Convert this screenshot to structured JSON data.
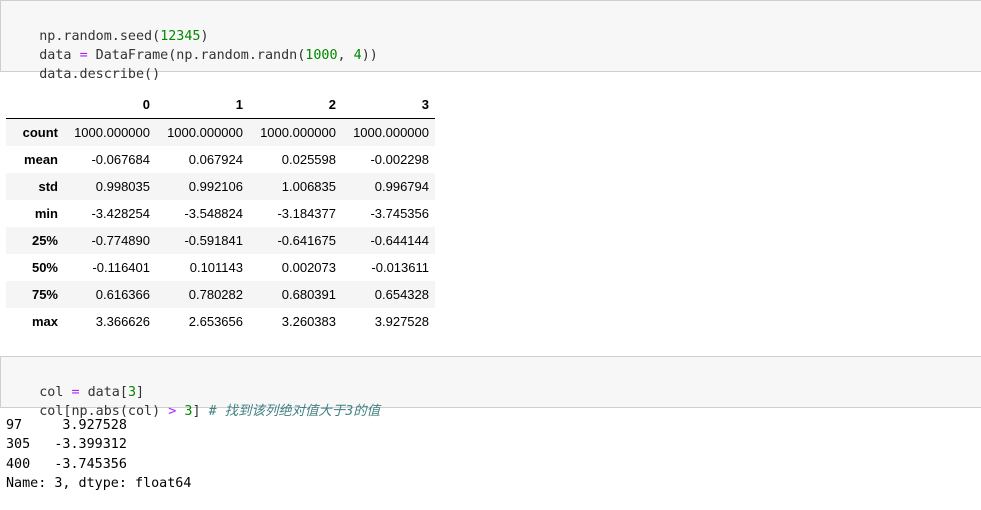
{
  "cell1": {
    "lines": [
      {
        "parts": [
          {
            "t": "np.random.seed(",
            "c": "plain"
          },
          {
            "t": "12345",
            "c": "num"
          },
          {
            "t": ")",
            "c": "plain"
          }
        ]
      },
      {
        "parts": [
          {
            "t": "data ",
            "c": "plain"
          },
          {
            "t": "=",
            "c": "op"
          },
          {
            "t": " DataFrame(np.random.randn(",
            "c": "plain"
          },
          {
            "t": "1000",
            "c": "num"
          },
          {
            "t": ", ",
            "c": "plain"
          },
          {
            "t": "4",
            "c": "num"
          },
          {
            "t": "))",
            "c": "plain"
          }
        ]
      },
      {
        "parts": [
          {
            "t": "data.describe()",
            "c": "plain"
          }
        ]
      }
    ]
  },
  "describe_table": {
    "columns": [
      "0",
      "1",
      "2",
      "3"
    ],
    "rows": [
      {
        "index": "count",
        "values": [
          "1000.000000",
          "1000.000000",
          "1000.000000",
          "1000.000000"
        ]
      },
      {
        "index": "mean",
        "values": [
          "-0.067684",
          "0.067924",
          "0.025598",
          "-0.002298"
        ]
      },
      {
        "index": "std",
        "values": [
          "0.998035",
          "0.992106",
          "1.006835",
          "0.996794"
        ]
      },
      {
        "index": "min",
        "values": [
          "-3.428254",
          "-3.548824",
          "-3.184377",
          "-3.745356"
        ]
      },
      {
        "index": "25%",
        "values": [
          "-0.774890",
          "-0.591841",
          "-0.641675",
          "-0.644144"
        ]
      },
      {
        "index": "50%",
        "values": [
          "-0.116401",
          "0.101143",
          "0.002073",
          "-0.013611"
        ]
      },
      {
        "index": "75%",
        "values": [
          "0.616366",
          "0.780282",
          "0.680391",
          "0.654328"
        ]
      },
      {
        "index": "max",
        "values": [
          "3.366626",
          "2.653656",
          "3.260383",
          "3.927528"
        ]
      }
    ]
  },
  "cell2": {
    "lines": [
      {
        "parts": [
          {
            "t": "col ",
            "c": "plain"
          },
          {
            "t": "=",
            "c": "op"
          },
          {
            "t": " data[",
            "c": "plain"
          },
          {
            "t": "3",
            "c": "num"
          },
          {
            "t": "]",
            "c": "plain"
          }
        ]
      },
      {
        "parts": [
          {
            "t": "col[np.abs(col) ",
            "c": "plain"
          },
          {
            "t": ">",
            "c": "op"
          },
          {
            "t": " ",
            "c": "plain"
          },
          {
            "t": "3",
            "c": "num"
          },
          {
            "t": "] ",
            "c": "plain"
          },
          {
            "t": "# 找到该列绝对值大于3的值",
            "c": "comment"
          }
        ]
      }
    ]
  },
  "output2": {
    "lines": [
      "97     3.927528",
      "305   -3.399312",
      "400   -3.745356",
      "Name: 3, dtype: float64"
    ]
  }
}
